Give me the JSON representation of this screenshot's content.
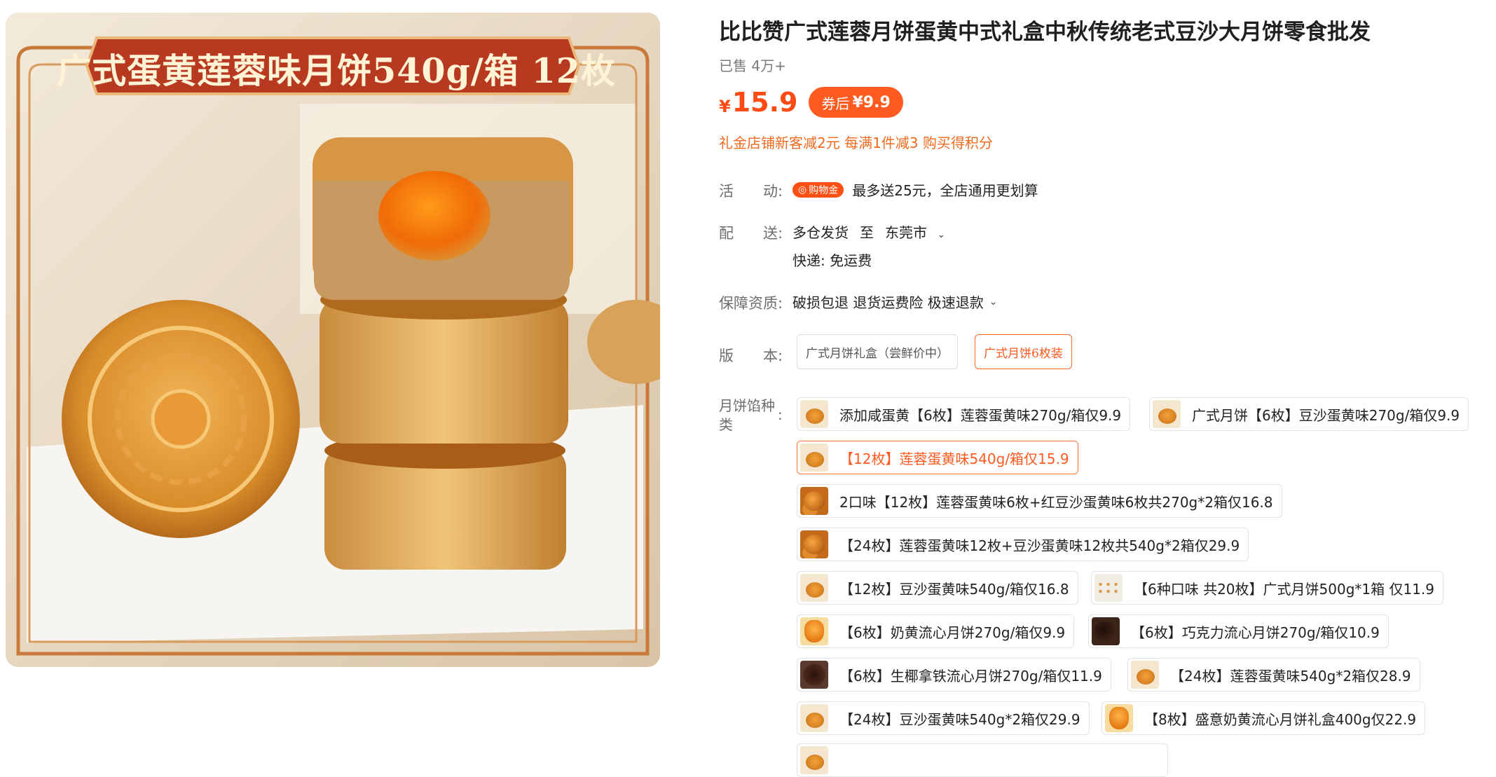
{
  "image": {
    "banner_text": "广式蛋黄莲蓉味月饼540g/箱  12枚"
  },
  "product": {
    "title": "比比赞广式莲蓉月饼蛋黄中式礼盒中秋传统老式豆沙大月饼零食批发",
    "sold": "已售 4万+",
    "currency": "¥",
    "price": "15.9",
    "coupon_label": "券后",
    "coupon_price": "¥9.9",
    "promo": "礼金店铺新客减2元 每满1件减3 购买得积分"
  },
  "activity": {
    "label": "活　　动:",
    "badge": "购物金",
    "text": "最多送25元，全店通用更划算"
  },
  "delivery": {
    "label": "配　　送:",
    "from": "多仓发货",
    "to_word": "至",
    "city": "东莞市",
    "express": "快递: 免运费"
  },
  "guarantee": {
    "label": "保障资质:",
    "text": "破损包退 退货运费险 极速退款"
  },
  "version": {
    "label": "版　　本:",
    "options": [
      "广式月饼礼盒（尝鲜价中）",
      "广式月饼6枚装"
    ],
    "selected": 1
  },
  "flavor": {
    "label": "月饼馅种类",
    "colon": ":",
    "options": [
      "添加咸蛋黄【6枚】莲蓉蛋黄味270g/箱仅9.9",
      "广式月饼【6枚】豆沙蛋黄味270g/箱仅9.9",
      "【12枚】莲蓉蛋黄味540g/箱仅15.9",
      "2口味【12枚】莲蓉蛋黄味6枚+红豆沙蛋黄味6枚共270g*2箱仅16.8",
      "【24枚】莲蓉蛋黄味12枚+豆沙蛋黄味12枚共540g*2箱仅29.9",
      "【12枚】豆沙蛋黄味540g/箱仅16.8",
      "【6种口味 共20枚】广式月饼500g*1箱 仅11.9",
      "【6枚】奶黄流心月饼270g/箱仅9.9",
      "【6枚】巧克力流心月饼270g/箱仅10.9",
      "【6枚】生椰拿铁流心月饼270g/箱仅11.9",
      "【24枚】莲蓉蛋黄味540g*2箱仅28.9",
      "【24枚】豆沙蛋黄味540g*2箱仅29.9",
      "【8枚】盛意奶黄流心月饼礼盒400g仅22.9"
    ],
    "selected": 2
  }
}
